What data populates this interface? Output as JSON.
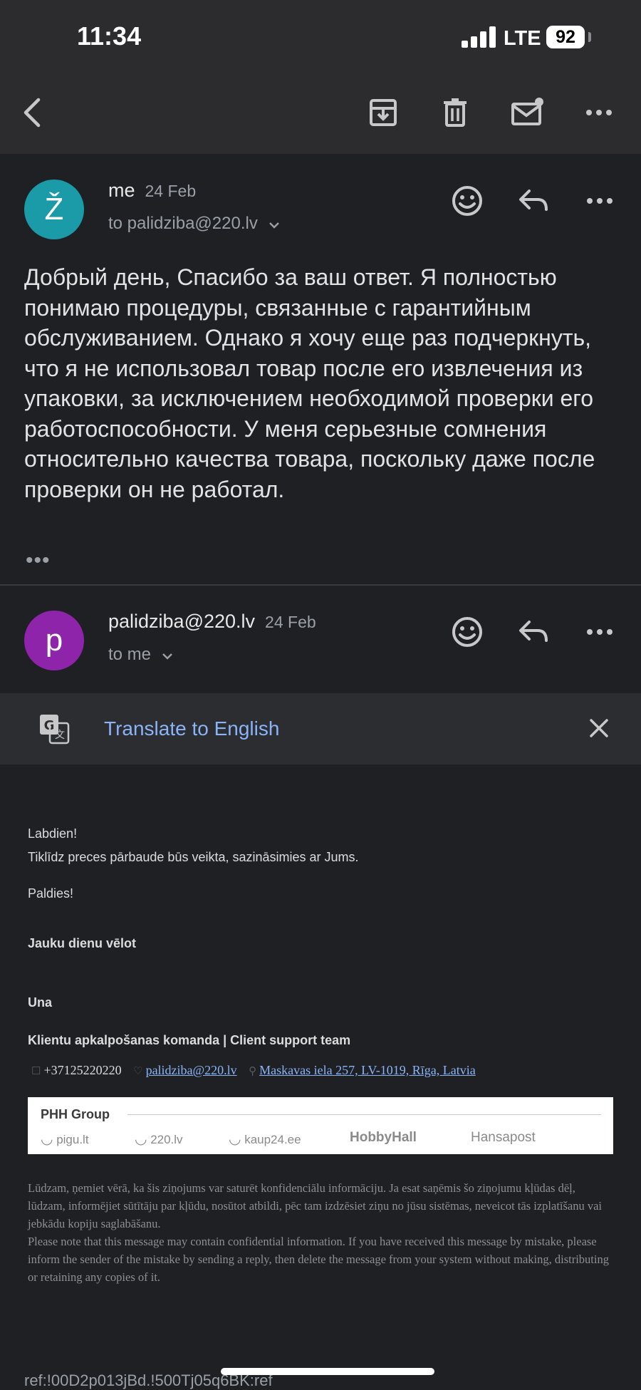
{
  "status": {
    "time": "11:34",
    "network": "LTE",
    "battery": "92"
  },
  "toolbar": {
    "icons": [
      "back-icon",
      "archive-icon",
      "delete-icon",
      "mark-unread-icon",
      "more-icon"
    ]
  },
  "messages": [
    {
      "avatar_letter": "Ž",
      "avatar_color": "#1b9aa8",
      "sender": "me",
      "date": "24 Feb",
      "to": "to palidziba@220.lv",
      "body": "Добрый день, Спасибо за ваш ответ. Я полностью понимаю процедуры, связанные с гарантийным обслуживанием. Однако я хочу еще раз подчеркнуть, что я не использовал товар после его извлечения из упаковки, за исключением необходимой проверки его работоспособности. У меня серьезные сомнения относительно качества товара, поскольку даже после проверки он не работал.",
      "trimmed": "•••"
    },
    {
      "avatar_letter": "p",
      "avatar_color": "#8e24aa",
      "sender": "palidziba@220.lv",
      "date": "24 Feb",
      "to": "to me"
    }
  ],
  "translate": {
    "label": "Translate to English"
  },
  "email": {
    "greeting": "Labdien!",
    "line1": "Tiklīdz preces pārbaude būs veikta, sazināsimies ar Jums.",
    "thanks": "Paldies!",
    "wish": "Jauku dienu vēlot",
    "name": "Una",
    "team": "Klientu apkalpošanas komanda | Client support team",
    "phone": "+37125220220",
    "email_link": "palidziba@220.lv",
    "address": "Maskavas iela 257, LV-1019, Rīga, Latvia",
    "group": "PHH Group",
    "brands": [
      "pigu.lt",
      "220.lv",
      "kaup24.ee",
      "HobbyHall",
      "Hansapost"
    ],
    "legal_lv": "Lūdzam, ņemiet vērā, ka šis ziņojums var saturēt konfidenciālu informāciju. Ja esat saņēmis šo ziņojumu kļūdas dēļ, lūdzam, informējiet sūtītāju par kļūdu, nosūtot atbildi, pēc tam izdzēsiet ziņu no jūsu sistēmas, neveicot tās izplatīšanu vai jebkādu kopiju saglabāšanu.",
    "legal_en": "Please note that this message may contain confidential information. If you have received this message by mistake, please inform the sender of the mistake by sending a reply, then delete the message from your system without making, distributing or retaining any copies of it.",
    "ref": "ref:!00D2p013jBd.!500Tj05q6BK:ref"
  }
}
